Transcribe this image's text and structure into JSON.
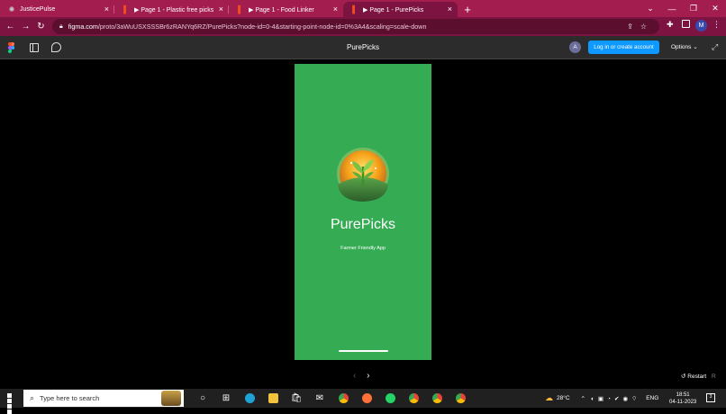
{
  "browser": {
    "tabs": [
      {
        "label": "JusticePulse",
        "active": false
      },
      {
        "label": "▶ Page 1 - Plastic free picks",
        "active": false
      },
      {
        "label": "▶ Page 1 - Food Linker",
        "active": false
      },
      {
        "label": "▶ Page 1 - PurePicks",
        "active": true
      }
    ],
    "url_host": "figma.com",
    "url_path": "/proto/3aWuUSXSSSBr6zRANYq6RZ/PurePicks?node-id=0-4&starting-point-node-id=0%3A4&scaling=scale-down",
    "profile_initial": "M",
    "colors": {
      "tabbar": "#a31e4f",
      "toolbar": "#7d1340"
    }
  },
  "figma": {
    "title": "PurePicks",
    "user_initial": "A",
    "login_label": "Log in or create account",
    "options_label": "Options ⌄",
    "restart_label": "Restart",
    "restart_key": "R",
    "accent": "#0d99ff"
  },
  "prototype": {
    "app_name": "PurePicks",
    "tagline": "Farmer Friendly App",
    "background": "#35ab54"
  },
  "taskbar": {
    "search_placeholder": "Type here to search",
    "weather": "28°C",
    "language": "ENG",
    "time": "18:51",
    "date": "04-11-2023",
    "notifications": "3"
  }
}
